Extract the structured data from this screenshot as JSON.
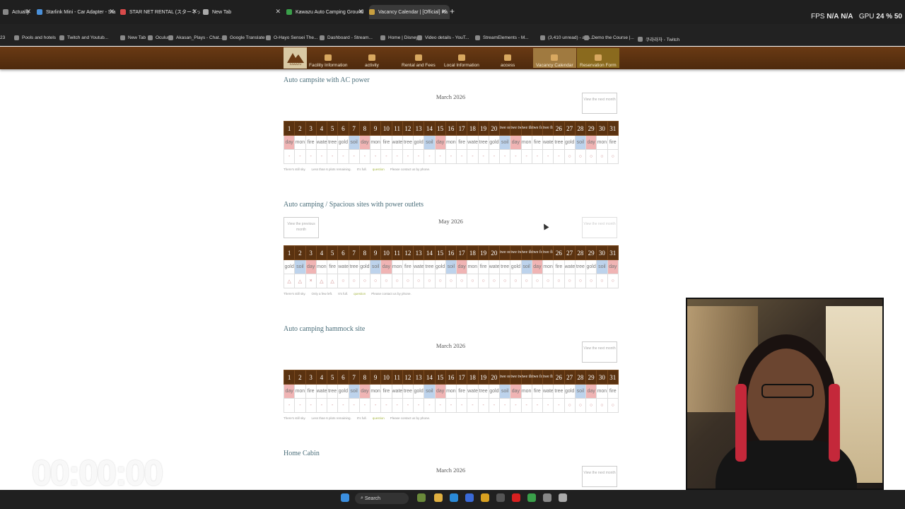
{
  "browser": {
    "tabs": [
      {
        "label": "Actually",
        "color": "#888"
      },
      {
        "label": "Starlink Mini - Car Adapter - Sta",
        "color": "#4a90d9"
      },
      {
        "label": "STAR NET RENTAL (スターネット)",
        "color": "#d94a4a"
      },
      {
        "label": "New Tab",
        "color": "#aaa"
      },
      {
        "label": "Kawazu Auto Camping Ground",
        "color": "#3aa04a"
      },
      {
        "label": "Vacancy Calendar | [Official] Ka",
        "color": "#c9a040"
      }
    ],
    "new_tab": "+",
    "overlay": {
      "fps_label": "FPS",
      "fps_value": "N/A",
      "fps_value2": "N/A",
      "gpu_label": "GPU",
      "gpu_value": "24 %",
      "gpu_extra": "50"
    },
    "bookmarks": [
      "23",
      "Pools and hotels",
      "Twitch and Youtub...",
      "New Tab",
      "Oculus",
      "Akasan_Plays - Chat...",
      "Google Translate",
      "O-Hayo Sensei The...",
      "Dashboard - Stream...",
      "Home | Disney+",
      "Video details - YouT...",
      "StreamElements - M...",
      "(3,410 unread) - aka...",
      "Demo the Course |...",
      "쿠라라자 - Twitch"
    ]
  },
  "site": {
    "logo_text": "KAWAZU",
    "nav": [
      "Facility Information",
      "activity",
      "Rental and Fees",
      "Local Information",
      "access",
      "Vacancy Calendar",
      "Reservation Form"
    ]
  },
  "sections": [
    {
      "title": "Auto campsite with AC power",
      "month": "March 2026",
      "prev": "",
      "next": "View the next month",
      "days": [
        "1",
        "2",
        "3",
        "4",
        "5",
        "6",
        "7",
        "8",
        "9",
        "10",
        "11",
        "12",
        "13",
        "14",
        "15",
        "16",
        "17",
        "18",
        "19",
        "20",
        "twe one",
        "twe two",
        "twe thre",
        "twe four",
        "twe five",
        "26",
        "27",
        "28",
        "29",
        "30",
        "31"
      ],
      "weekdays": [
        "day",
        "mon",
        "fire",
        "water",
        "tree",
        "gold",
        "soil",
        "day",
        "mon",
        "fire",
        "water",
        "tree",
        "gold",
        "soil",
        "day",
        "mon",
        "fire",
        "water",
        "tree",
        "gold",
        "soil",
        "day",
        "mon",
        "fire",
        "water",
        "tree",
        "gold",
        "soil",
        "day",
        "mon",
        "fire"
      ],
      "status": [
        "-",
        "-",
        "-",
        "-",
        "-",
        "-",
        "-",
        "-",
        "-",
        "-",
        "-",
        "-",
        "-",
        "-",
        "-",
        "-",
        "-",
        "-",
        "-",
        "-",
        "-",
        "-",
        "-",
        "-",
        "-",
        "-",
        "○",
        "○",
        "○",
        "○",
        "○"
      ],
      "legend": [
        "There's still sky.",
        "Less than 6 plots remaining.",
        "It's full.",
        "question",
        "Please contact us by phone."
      ]
    },
    {
      "title": "Auto camping / Spacious sites with power outlets",
      "month": "May 2026",
      "prev": "View the previous month",
      "next": "View the next month",
      "days": [
        "1",
        "2",
        "3",
        "4",
        "5",
        "6",
        "7",
        "8",
        "9",
        "10",
        "11",
        "12",
        "13",
        "14",
        "15",
        "16",
        "17",
        "18",
        "19",
        "20",
        "twe one",
        "twe two",
        "twe thre",
        "twe four",
        "twe five",
        "26",
        "27",
        "28",
        "29",
        "30",
        "31"
      ],
      "weekdays": [
        "gold",
        "soil",
        "day",
        "mon",
        "fire",
        "water",
        "tree",
        "gold",
        "soil",
        "day",
        "mon",
        "fire",
        "water",
        "tree",
        "gold",
        "soil",
        "day",
        "mon",
        "fire",
        "water",
        "tree",
        "gold",
        "soil",
        "day",
        "mon",
        "fire",
        "water",
        "tree",
        "gold",
        "soil",
        "day"
      ],
      "status": [
        "△",
        "△",
        "×",
        "△",
        "△",
        "○",
        "○",
        "○",
        "○",
        "○",
        "○",
        "○",
        "○",
        "○",
        "○",
        "○",
        "○",
        "○",
        "○",
        "○",
        "○",
        "○",
        "○",
        "○",
        "○",
        "○",
        "○",
        "○",
        "○",
        "○",
        "○"
      ],
      "legend": [
        "There's still sky.",
        "Only a few left.",
        "It's full.",
        "question",
        "Please contact us by phone."
      ]
    },
    {
      "title": "Auto camping hammock site",
      "month": "March 2026",
      "prev": "",
      "next": "View the next month",
      "days": [
        "1",
        "2",
        "3",
        "4",
        "5",
        "6",
        "7",
        "8",
        "9",
        "10",
        "11",
        "12",
        "13",
        "14",
        "15",
        "16",
        "17",
        "18",
        "19",
        "20",
        "twe one",
        "twe two",
        "twe thre",
        "twe four",
        "twe five",
        "26",
        "27",
        "28",
        "29",
        "30",
        "31"
      ],
      "weekdays": [
        "day",
        "mon",
        "fire",
        "water",
        "tree",
        "gold",
        "soil",
        "day",
        "mon",
        "fire",
        "water",
        "tree",
        "gold",
        "soil",
        "day",
        "mon",
        "fire",
        "water",
        "tree",
        "gold",
        "soil",
        "day",
        "mon",
        "fire",
        "water",
        "tree",
        "gold",
        "soil",
        "day",
        "mon",
        "fire"
      ],
      "status": [
        "-",
        "-",
        "-",
        "-",
        "-",
        "-",
        "-",
        "-",
        "-",
        "-",
        "-",
        "-",
        "-",
        "-",
        "-",
        "-",
        "-",
        "-",
        "-",
        "-",
        "-",
        "-",
        "-",
        "-",
        "-",
        "-",
        "○",
        "○",
        "○",
        "○",
        "○"
      ],
      "legend": [
        "There's still sky.",
        "Less than 6 plots remaining.",
        "It's full.",
        "question",
        "Please contact us by phone."
      ]
    },
    {
      "title": "Home Cabin",
      "month": "March 2026",
      "prev": "",
      "next": "View the next month"
    }
  ],
  "taskbar": {
    "search": "Search"
  },
  "colors": {
    "nav_bg": "#5a3210",
    "sat": "#bdd3ec",
    "sun": "#f0b4b4",
    "title": "#4a6e7a"
  }
}
